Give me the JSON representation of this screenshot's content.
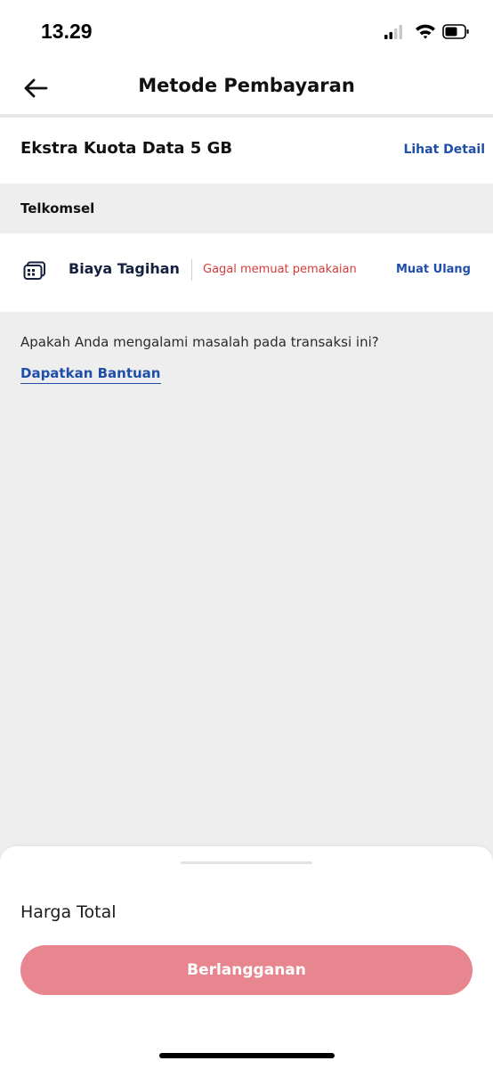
{
  "status_bar": {
    "time": "13.29",
    "icons": [
      "signal-icon",
      "wifi-icon",
      "battery-icon"
    ]
  },
  "header": {
    "title": "Metode Pembayaran",
    "back_icon": "arrow-left-icon"
  },
  "product": {
    "name": "Ekstra Kuota Data 5 GB",
    "detail_link": "Lihat Detail"
  },
  "section": {
    "label": "Telkomsel"
  },
  "payment": {
    "icon": "sim-card-icon",
    "method": "Biaya Tagihan",
    "error": "Gagal memuat pemakaian",
    "reload": "Muat Ulang"
  },
  "help": {
    "question": "Apakah Anda mengalami masalah pada transaksi ini?",
    "link": "Dapatkan Bantuan"
  },
  "bottom_sheet": {
    "total_label": "Harga Total",
    "button_label": "Berlangganan"
  },
  "colors": {
    "link": "#1f4fa8",
    "error": "#d63b3b",
    "button": "#e8868f",
    "background": "#eeeeee"
  }
}
